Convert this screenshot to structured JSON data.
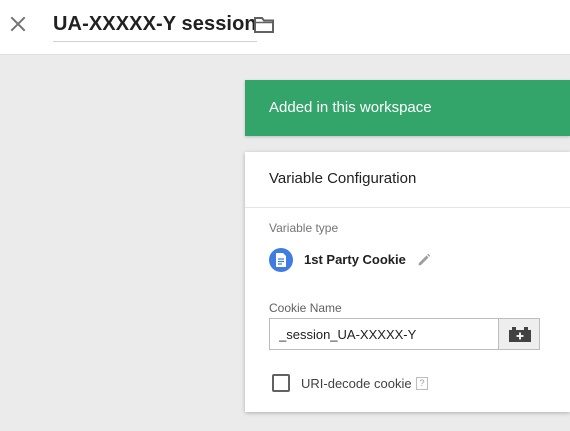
{
  "header": {
    "title": "UA-XXXXX-Y session",
    "close_icon": "close-icon",
    "folder_icon": "folder-icon"
  },
  "banner": {
    "text": "Added in this workspace",
    "color": "#33a56a"
  },
  "config": {
    "title": "Variable Configuration",
    "variable_type_label": "Variable type",
    "variable_type_name": "1st Party Cookie",
    "variable_type_icon": "document-icon",
    "variable_type_icon_color": "#3f7de3",
    "edit_icon": "pencil-icon",
    "cookie_name_label": "Cookie Name",
    "cookie_name_value": "_session_UA-XXXXX-Y",
    "variable_picker_icon": "brick-plus-icon",
    "uri_decode_label": "URI-decode cookie",
    "uri_decode_checked": false,
    "help_text": "?"
  }
}
